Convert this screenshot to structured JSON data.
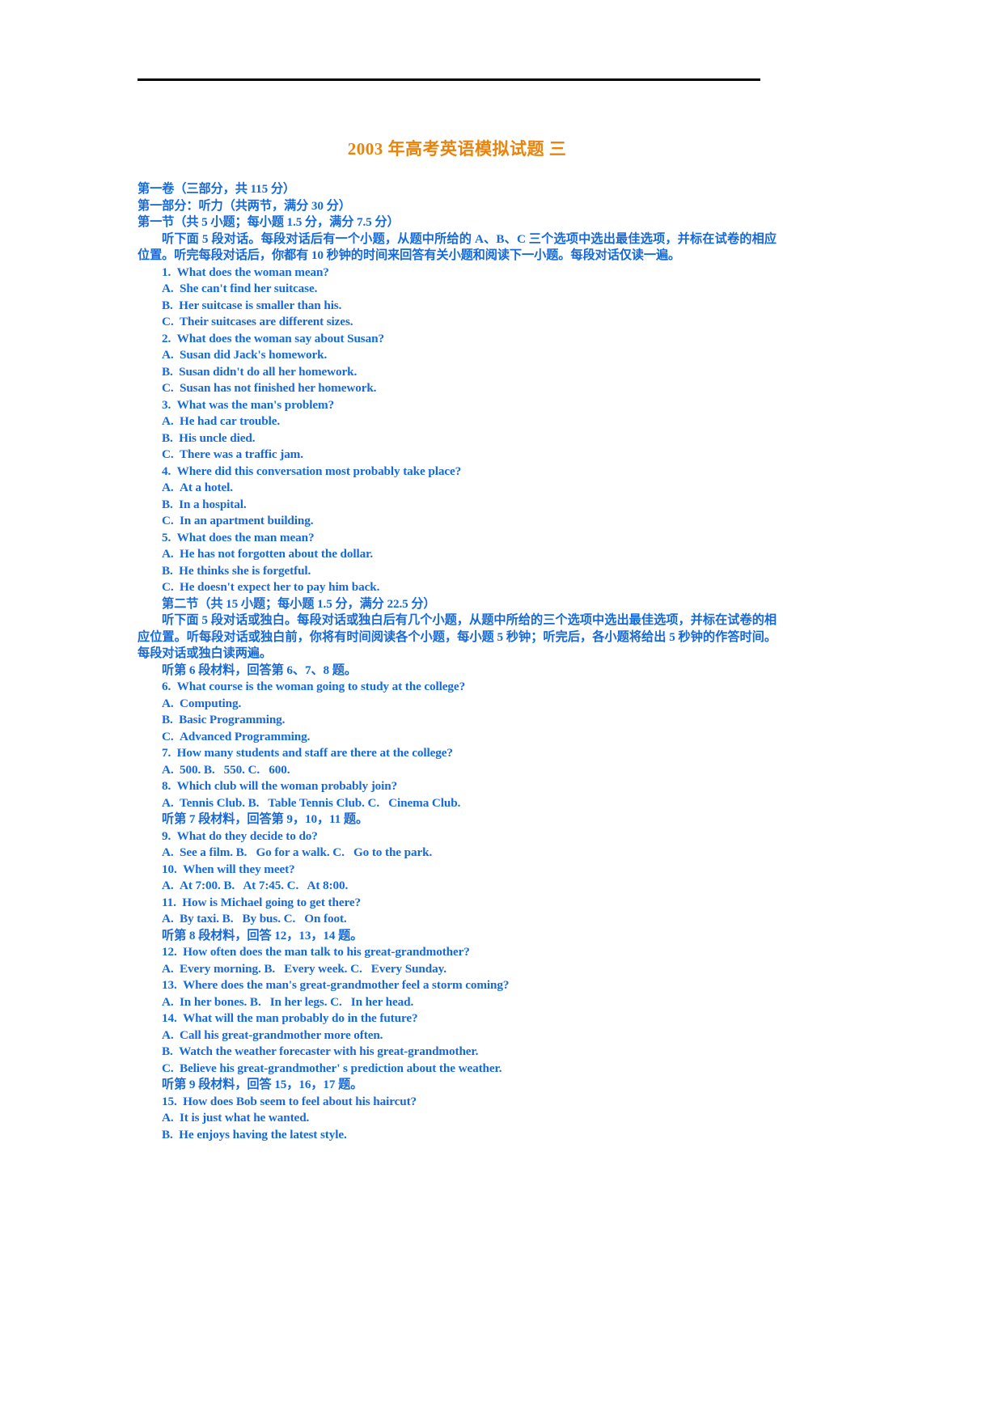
{
  "document": {
    "title": "2003 年高考英语模拟试题 三",
    "title_color": "#E8830C",
    "body_color": "#1569DB"
  },
  "header_lines": [
    "第一卷（三部分，共 115 分）",
    "第一部分：听力（共两节，满分 30 分）",
    "第一节（共 5 小题；每小题 1.5 分，满分 7.5 分）"
  ],
  "instructions_1": "听下面 5 段对话。每段对话后有一个小题，从题中所给的 A、B、C 三个选项中选出最佳选项，并标在试卷的相应位置。听完每段对话后，你都有 10 秒钟的时间来回答有关小题和阅读下一小题。每段对话仅读一遍。",
  "section1_questions": [
    {
      "num": "1.",
      "text": "What does the woman mean?"
    },
    {
      "num": "A.",
      "text": "She can't find her suitcase."
    },
    {
      "num": "B.",
      "text": "Her suitcase is smaller than his."
    },
    {
      "num": "C.",
      "text": "Their suitcases are different sizes."
    },
    {
      "num": "2.",
      "text": "What does the woman say about Susan?"
    },
    {
      "num": "A.",
      "text": "Susan did Jack's homework."
    },
    {
      "num": "B.",
      "text": "Susan didn't do all her homework."
    },
    {
      "num": "C.",
      "text": "Susan has not finished her homework."
    },
    {
      "num": "3.",
      "text": "What was the man's problem?"
    },
    {
      "num": "A.",
      "text": "He had car trouble."
    },
    {
      "num": "B.",
      "text": "His uncle died."
    },
    {
      "num": "C.",
      "text": "There was a traffic jam."
    },
    {
      "num": "4.",
      "text": "Where did this conversation most probably take place?"
    },
    {
      "num": "A.",
      "text": "At a hotel."
    },
    {
      "num": "B.",
      "text": "In a hospital."
    },
    {
      "num": "C.",
      "text": "In an apartment building."
    },
    {
      "num": "5.",
      "text": "What does the man mean?"
    },
    {
      "num": "A.",
      "text": "He has not forgotten about the dollar."
    },
    {
      "num": "B.",
      "text": "He thinks she is forgetful."
    },
    {
      "num": "C.",
      "text": "He doesn't expect her to pay him back."
    }
  ],
  "section2_header": "第二节（共 15 小题；每小题 1.5 分，满分 22.5 分）",
  "instructions_2": "听下面 5 段对话或独白。每段对话或独白后有几个小题，从题中所给的三个选项中选出最佳选项，并标在试卷的相应位置。听每段对话或独白前，你将有时间阅读各个小题，每小题 5 秒钟；听完后，各小题将给出 5 秒钟的作答时间。每段对话或独白读两遍。",
  "material_groups": [
    {
      "heading": "听第 6 段材料，回答第 6、7、8 题。",
      "items": [
        {
          "num": "6.",
          "text": "What course is the woman going to study at the college?"
        },
        {
          "num": "A.",
          "text": "Computing."
        },
        {
          "num": "B.",
          "text": "Basic Programming."
        },
        {
          "num": "C.",
          "text": "Advanced Programming."
        },
        {
          "num": "7.",
          "text": "How many students and staff are there at the college?"
        },
        {
          "num": "A.",
          "text": "500. B.   550. C.   600."
        },
        {
          "num": "8.",
          "text": "Which club will the woman probably join?"
        },
        {
          "num": "A.",
          "text": "Tennis Club. B.   Table Tennis Club. C.   Cinema Club."
        }
      ]
    },
    {
      "heading": "听第 7 段材料，回答第 9，10，11 题。",
      "items": [
        {
          "num": "9.",
          "text": "What do they decide to do?"
        },
        {
          "num": "A.",
          "text": "See a film. B.   Go for a walk. C.   Go to the park."
        },
        {
          "num": "10.",
          "text": "When will they meet?"
        },
        {
          "num": "A.",
          "text": "At 7:00. B.   At 7:45. C.   At 8:00."
        },
        {
          "num": "11.",
          "text": "How is Michael going to get there?"
        },
        {
          "num": "A.",
          "text": "By taxi. B.   By bus. C.   On foot."
        }
      ]
    },
    {
      "heading": "听第 8 段材料，回答 12，13，14 题。",
      "items": [
        {
          "num": "12.",
          "text": "How often does the man talk to his great-grandmother?"
        },
        {
          "num": "A.",
          "text": "Every morning. B.   Every week. C.   Every Sunday."
        },
        {
          "num": "13.",
          "text": "Where does the man's great-grandmother feel a storm coming?"
        },
        {
          "num": "A.",
          "text": "In her bones. B.   In her legs. C.   In her head."
        },
        {
          "num": "14.",
          "text": "What will the man probably do in the future?"
        },
        {
          "num": "A.",
          "text": "Call his great-grandmother more often."
        },
        {
          "num": "B.",
          "text": "Watch the weather forecaster with his great-grandmother."
        },
        {
          "num": "C.",
          "text": "Believe his great-grandmother' s prediction about the weather."
        }
      ]
    },
    {
      "heading": "听第 9 段材料，回答 15，16，17 题。",
      "items": [
        {
          "num": "15.",
          "text": "How does Bob seem to feel about his haircut?"
        },
        {
          "num": "A.",
          "text": "It is just what he wanted."
        },
        {
          "num": "B.",
          "text": "He enjoys having the latest style."
        }
      ]
    }
  ]
}
